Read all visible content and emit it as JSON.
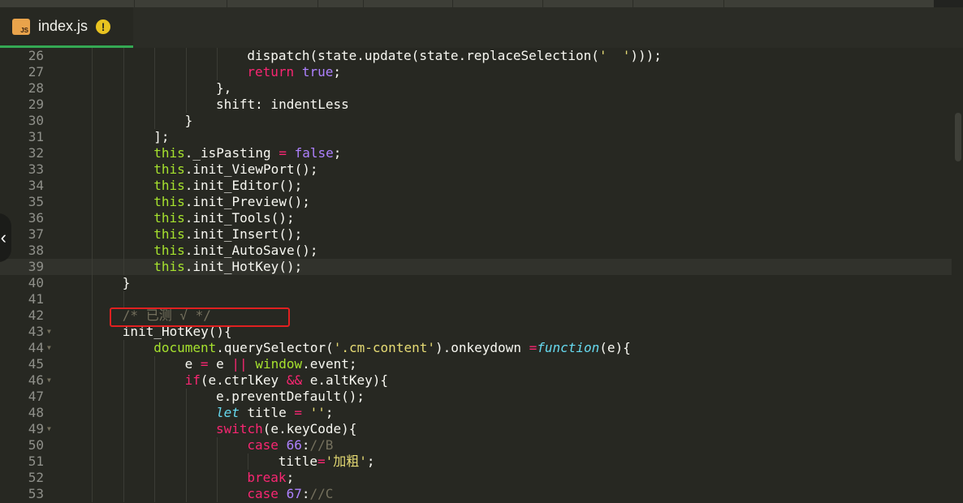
{
  "tab": {
    "badge": "JS",
    "filename": "index.js",
    "warning_glyph": "!"
  },
  "sidebar_toggle": "‹",
  "lines": [
    {
      "num": "26",
      "indent": 6,
      "fold": false,
      "tokens": [
        [
          "dispatch(state.update(state.replaceSelection(",
          ""
        ],
        [
          "'  '",
          "s"
        ],
        [
          ")));",
          ""
        ]
      ]
    },
    {
      "num": "27",
      "indent": 6,
      "fold": false,
      "tokens": [
        [
          "return",
          "k"
        ],
        [
          " ",
          ""
        ],
        [
          "true",
          "n"
        ],
        [
          ";",
          ""
        ]
      ]
    },
    {
      "num": "28",
      "indent": 5,
      "fold": false,
      "tokens": [
        [
          "},",
          ""
        ]
      ]
    },
    {
      "num": "29",
      "indent": 5,
      "fold": false,
      "tokens": [
        [
          "shift: indentLess",
          ""
        ]
      ]
    },
    {
      "num": "30",
      "indent": 4,
      "fold": false,
      "tokens": [
        [
          "}",
          ""
        ]
      ]
    },
    {
      "num": "31",
      "indent": 3,
      "fold": false,
      "tokens": [
        [
          "];",
          ""
        ]
      ]
    },
    {
      "num": "32",
      "indent": 3,
      "fold": false,
      "tokens": [
        [
          "this",
          "t"
        ],
        [
          "._isPasting ",
          ""
        ],
        [
          "=",
          "k"
        ],
        [
          " ",
          ""
        ],
        [
          "false",
          "n"
        ],
        [
          ";",
          ""
        ]
      ]
    },
    {
      "num": "33",
      "indent": 3,
      "fold": false,
      "tokens": [
        [
          "this",
          "t"
        ],
        [
          ".init_ViewPort();",
          ""
        ]
      ]
    },
    {
      "num": "34",
      "indent": 3,
      "fold": false,
      "tokens": [
        [
          "this",
          "t"
        ],
        [
          ".init_Editor();",
          ""
        ]
      ]
    },
    {
      "num": "35",
      "indent": 3,
      "fold": false,
      "tokens": [
        [
          "this",
          "t"
        ],
        [
          ".init_Preview();",
          ""
        ]
      ]
    },
    {
      "num": "36",
      "indent": 3,
      "fold": false,
      "tokens": [
        [
          "this",
          "t"
        ],
        [
          ".init_Tools();",
          ""
        ]
      ]
    },
    {
      "num": "37",
      "indent": 3,
      "fold": false,
      "tokens": [
        [
          "this",
          "t"
        ],
        [
          ".init_Insert();",
          ""
        ]
      ]
    },
    {
      "num": "38",
      "indent": 3,
      "fold": false,
      "tokens": [
        [
          "this",
          "t"
        ],
        [
          ".init_AutoSave();",
          ""
        ]
      ]
    },
    {
      "num": "39",
      "indent": 3,
      "fold": false,
      "active": true,
      "tokens": [
        [
          "this",
          "t"
        ],
        [
          ".init_HotKey();",
          ""
        ]
      ]
    },
    {
      "num": "40",
      "indent": 2,
      "fold": false,
      "tokens": [
        [
          "}",
          ""
        ]
      ]
    },
    {
      "num": "41",
      "indent": 0,
      "fold": false,
      "tokens": []
    },
    {
      "num": "42",
      "indent": 2,
      "fold": false,
      "tokens": [
        [
          "/* 已测 √ */",
          "c"
        ]
      ]
    },
    {
      "num": "43",
      "indent": 2,
      "fold": true,
      "tokens": [
        [
          "init_HotKey(){",
          ""
        ]
      ]
    },
    {
      "num": "44",
      "indent": 3,
      "fold": true,
      "tokens": [
        [
          "document",
          "t"
        ],
        [
          ".querySelector(",
          ""
        ],
        [
          "'.cm-content'",
          "s"
        ],
        [
          ").onkeydown ",
          ""
        ],
        [
          "=",
          "k"
        ],
        [
          "function",
          "f"
        ],
        [
          "(e){",
          ""
        ]
      ]
    },
    {
      "num": "45",
      "indent": 4,
      "fold": false,
      "tokens": [
        [
          "e ",
          ""
        ],
        [
          "=",
          "k"
        ],
        [
          " e ",
          ""
        ],
        [
          "||",
          "k"
        ],
        [
          " ",
          ""
        ],
        [
          "window",
          "t"
        ],
        [
          ".event;",
          ""
        ]
      ]
    },
    {
      "num": "46",
      "indent": 4,
      "fold": true,
      "tokens": [
        [
          "if",
          "k"
        ],
        [
          "(e.ctrlKey ",
          ""
        ],
        [
          "&&",
          "k"
        ],
        [
          " e.altKey){",
          ""
        ]
      ]
    },
    {
      "num": "47",
      "indent": 5,
      "fold": false,
      "tokens": [
        [
          "e.preventDefault();",
          ""
        ]
      ]
    },
    {
      "num": "48",
      "indent": 5,
      "fold": false,
      "tokens": [
        [
          "let",
          "f"
        ],
        [
          " title ",
          ""
        ],
        [
          "=",
          "k"
        ],
        [
          " ",
          ""
        ],
        [
          "''",
          "s"
        ],
        [
          ";",
          ""
        ]
      ]
    },
    {
      "num": "49",
      "indent": 5,
      "fold": true,
      "tokens": [
        [
          "switch",
          "k"
        ],
        [
          "(e.keyCode){",
          ""
        ]
      ]
    },
    {
      "num": "50",
      "indent": 6,
      "fold": false,
      "tokens": [
        [
          "case",
          "k"
        ],
        [
          " ",
          ""
        ],
        [
          "66",
          "n"
        ],
        [
          ":",
          ""
        ],
        [
          "//B",
          "c"
        ]
      ]
    },
    {
      "num": "51",
      "indent": 7,
      "fold": false,
      "tokens": [
        [
          "title",
          ""
        ],
        [
          "=",
          "k"
        ],
        [
          "'加粗'",
          "s"
        ],
        [
          ";",
          ""
        ]
      ]
    },
    {
      "num": "52",
      "indent": 6,
      "fold": false,
      "tokens": [
        [
          "break",
          "k"
        ],
        [
          ";",
          ""
        ]
      ]
    },
    {
      "num": "53",
      "indent": 6,
      "fold": false,
      "tokens": [
        [
          "case",
          "k"
        ],
        [
          " ",
          ""
        ],
        [
          "67",
          "n"
        ],
        [
          ":",
          ""
        ],
        [
          "//C",
          "c"
        ]
      ]
    }
  ]
}
